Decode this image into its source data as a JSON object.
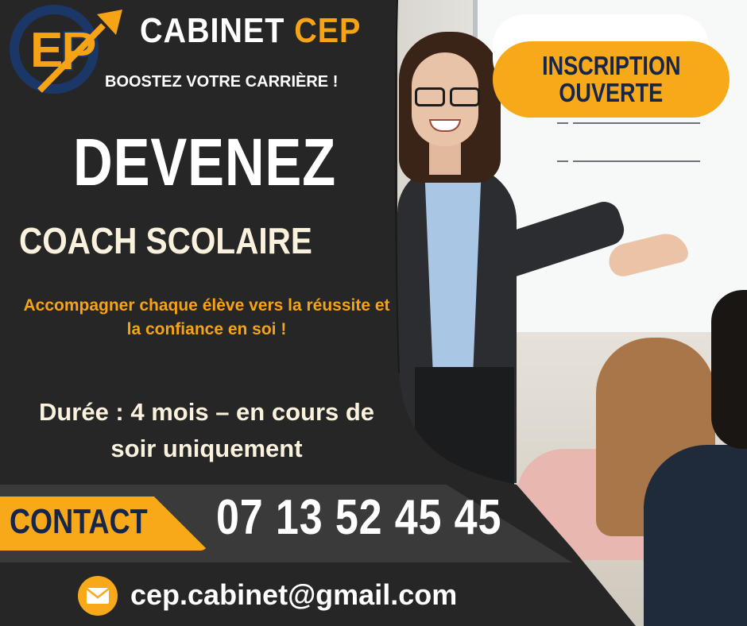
{
  "brand": {
    "name_part1": "CABINET",
    "name_part2": "CEP",
    "logo_text": "CEP",
    "tagline": "BOOSTEZ VOTRE CARRIÈRE !"
  },
  "badge": {
    "line1": "INSCRIPTION",
    "line2": "OUVERTE"
  },
  "headline": {
    "line1": "DEVENEZ",
    "line2": "COACH SCOLAIRE"
  },
  "subline": "Accompagner chaque élève vers la réussite et la confiance en soi !",
  "duration": "Durée : 4 mois – en cours de soir uniquement",
  "contact": {
    "label": "CONTACT",
    "phone": "07 13 52 45 45"
  },
  "email": {
    "icon": "envelope-icon",
    "address": "cep.cabinet@gmail.com"
  },
  "colors": {
    "accent": "#f8a91a",
    "navy": "#16254a",
    "background": "#222222",
    "cream": "#fbf2de"
  }
}
